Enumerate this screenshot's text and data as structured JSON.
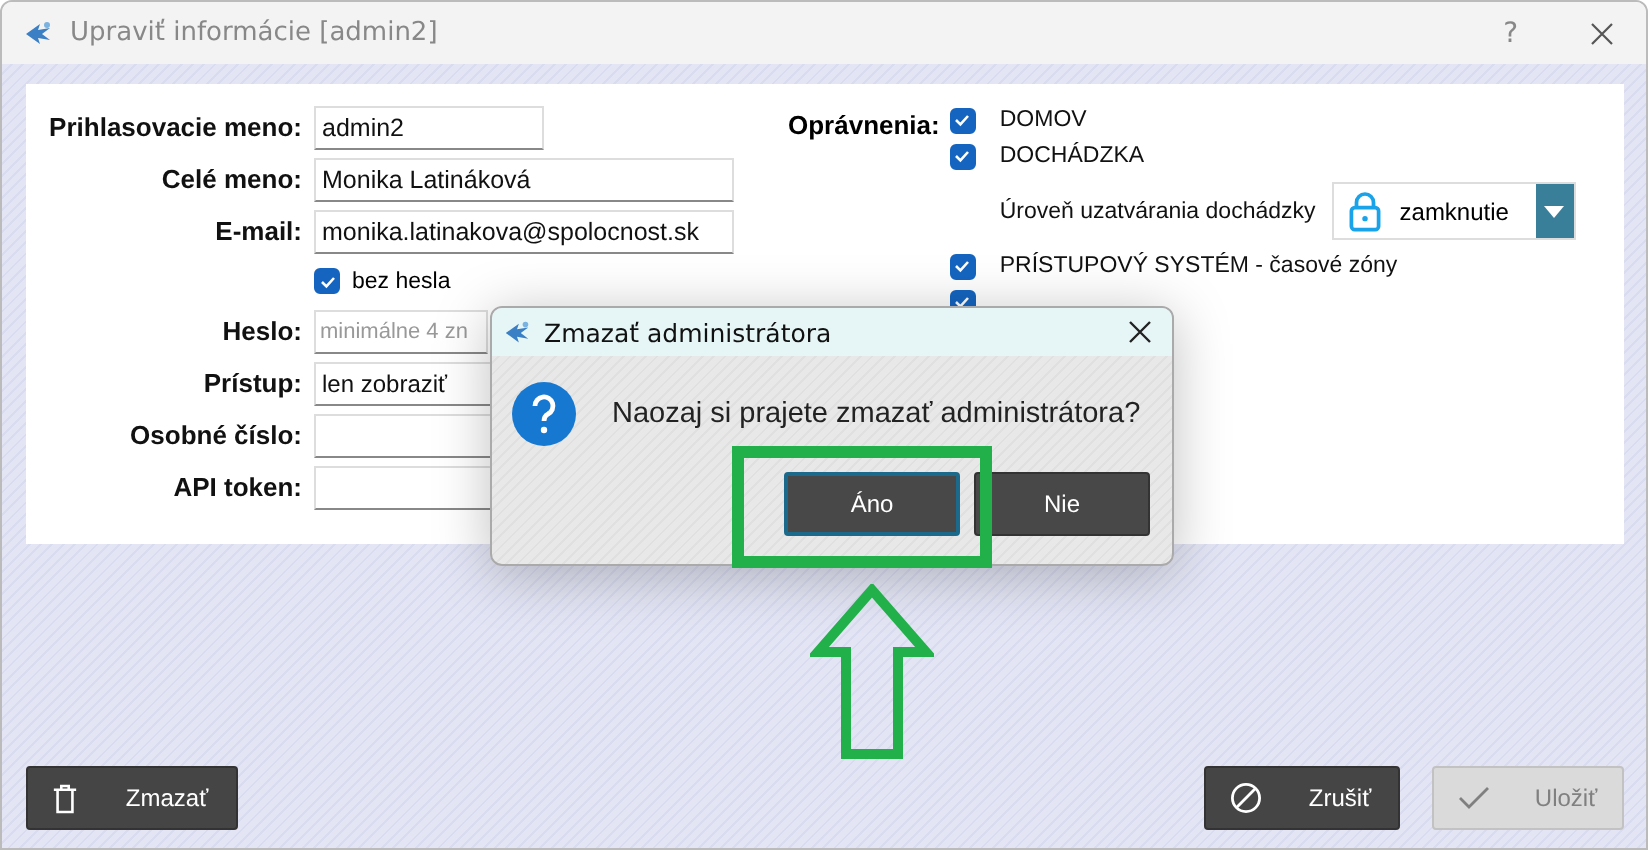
{
  "window": {
    "title": "Upraviť informácie [admin2]",
    "help": "?"
  },
  "form": {
    "fields": [
      {
        "label": "Prihlasovacie meno:",
        "kind": "text",
        "value": "admin2"
      },
      {
        "label": "Celé meno:",
        "kind": "text",
        "value": "Monika Latináková"
      },
      {
        "label": "E-mail:",
        "kind": "text",
        "value": "monika.latinakova@spolocnost.sk"
      },
      {
        "kind": "checkbox",
        "text": "bez hesla",
        "checked": true
      },
      {
        "label": "Heslo:",
        "kind": "text",
        "placeholder": "minimálne 4 zn"
      },
      {
        "label": "Prístup:",
        "kind": "select",
        "value": "len zobraziť"
      },
      {
        "label": "Osobné číslo:",
        "kind": "text"
      },
      {
        "label": "API token:",
        "kind": "text"
      }
    ]
  },
  "permissions": {
    "label": "Oprávnenia:",
    "items": [
      {
        "kind": "checkbox",
        "text": "DOMOV",
        "checked": true
      },
      {
        "kind": "checkbox",
        "text": "DOCHÁDZKA",
        "checked": true
      },
      {
        "kind": "select",
        "text": "Úroveň uzatvárania dochádzky",
        "value": "zamknutie"
      },
      {
        "kind": "checkbox",
        "text": "PRÍSTUPOVÝ SYSTÉM - časové zóny",
        "checked": true
      },
      {
        "kind": "checkbox",
        "checked": true
      }
    ]
  },
  "dialog": {
    "title": "Zmazať administrátora",
    "message": "Naozaj si prajete zmazať administrátora?",
    "buttons": [
      {
        "label": "Áno",
        "selected": true
      },
      {
        "label": "Nie",
        "selected": false
      }
    ]
  },
  "footer": {
    "buttons": [
      {
        "kind": "delete",
        "label": "Zmazať",
        "disabled": false
      },
      {
        "kind": "cancel",
        "label": "Zrušiť",
        "disabled": false
      },
      {
        "kind": "save",
        "label": "Uložiť",
        "disabled": true
      }
    ]
  }
}
